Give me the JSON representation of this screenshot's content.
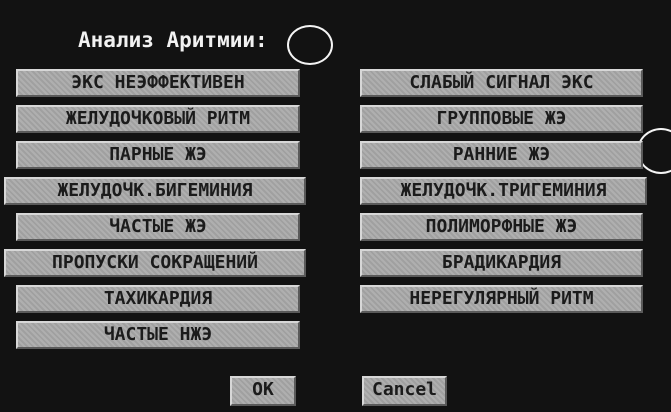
{
  "dialog": {
    "title": "Анализ Аритмии:",
    "left_options": [
      "ЭКС НЕЭФФЕКТИВЕН",
      "ЖЕЛУДОЧКОВЫЙ РИТМ",
      "ПАРНЫЕ ЖЭ",
      "ЖЕЛУДОЧК.БИГЕМИНИЯ",
      "ЧАСТЫЕ ЖЭ",
      "ПРОПУСКИ СОКРАЩЕНИЙ",
      "ТАХИКАРДИЯ",
      "ЧАСТЫЕ НЖЭ"
    ],
    "right_options": [
      "СЛАБЫЙ СИГНАЛ ЭКС",
      "ГРУППОВЫЕ ЖЭ",
      "РАННИЕ ЖЭ",
      "ЖЕЛУДОЧК.ТРИГЕМИНИЯ",
      "ПОЛИМОРФНЫЕ ЖЭ",
      "БРАДИКАРДИЯ",
      "НЕРЕГУЛЯРНЫЙ РИТМ"
    ],
    "ok_label": "OK",
    "cancel_label": "Cancel"
  }
}
